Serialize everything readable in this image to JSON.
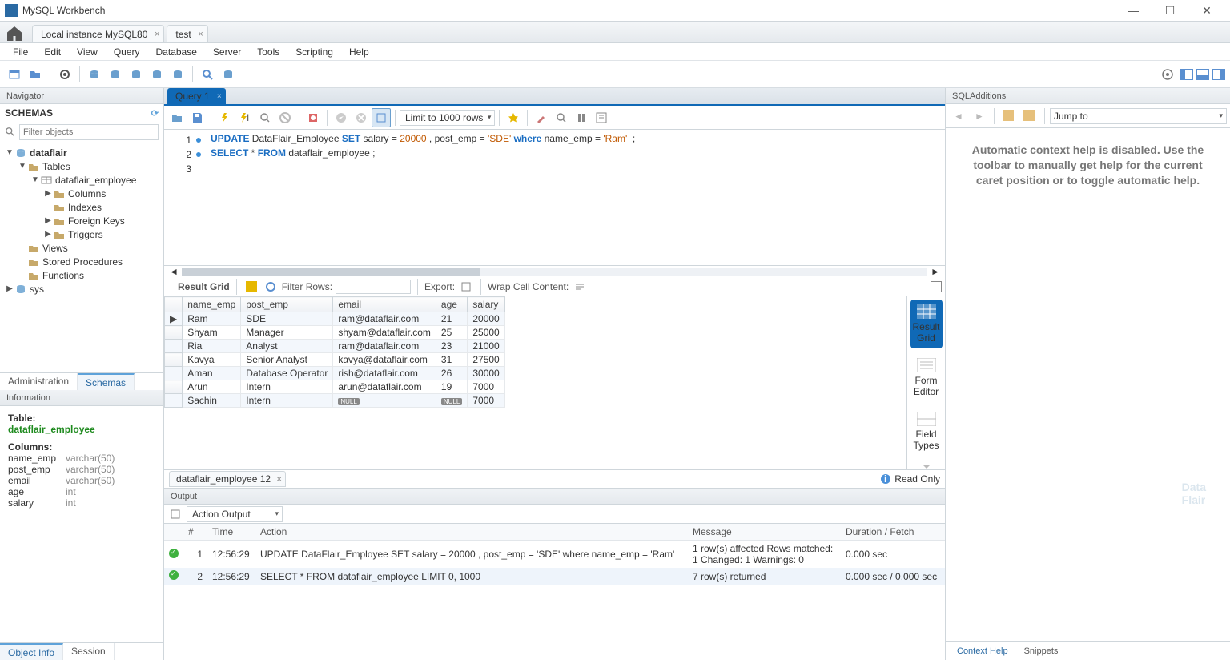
{
  "title": "MySQL Workbench",
  "connTabs": [
    "Local instance MySQL80",
    "test"
  ],
  "menu": [
    "File",
    "Edit",
    "View",
    "Query",
    "Database",
    "Server",
    "Tools",
    "Scripting",
    "Help"
  ],
  "navigator": {
    "head": "Navigator",
    "schemasLabel": "SCHEMAS",
    "filterPlaceholder": "Filter objects",
    "tree": {
      "db": "dataflair",
      "tables": "Tables",
      "table": "dataflair_employee",
      "columns": "Columns",
      "indexes": "Indexes",
      "fks": "Foreign Keys",
      "triggers": "Triggers",
      "views": "Views",
      "sps": "Stored Procedures",
      "funcs": "Functions",
      "sys": "sys"
    },
    "tabs": {
      "admin": "Administration",
      "schemas": "Schemas"
    }
  },
  "info": {
    "head": "Information",
    "tableLabel": "Table:",
    "tableName": "dataflair_employee",
    "columnsLabel": "Columns:",
    "cols": [
      [
        "name_emp",
        "varchar(50)"
      ],
      [
        "post_emp",
        "varchar(50)"
      ],
      [
        "email",
        "varchar(50)"
      ],
      [
        "age",
        "int"
      ],
      [
        "salary",
        "int"
      ]
    ],
    "tabs": {
      "obj": "Object Info",
      "session": "Session"
    }
  },
  "query": {
    "tab": "Query 1",
    "limit": "Limit to 1000 rows",
    "lines": [
      {
        "n": "1",
        "dot": true,
        "html": "<span class='kw'>UPDATE</span> DataFlair_Employee <span class='kw'>SET</span> salary = <span class='num'>20000</span> , post_emp = <span class='str'>'SDE'</span> <span class='kw'>where</span> name_emp = <span class='str'>'Ram'</span>  ;"
      },
      {
        "n": "2",
        "dot": true,
        "html": "<span class='kw'>SELECT</span> * <span class='kw'>FROM</span> dataflair_employee ;"
      },
      {
        "n": "3",
        "dot": false,
        "html": "<span class='cursor'></span>"
      }
    ]
  },
  "result": {
    "barLabel": "Result Grid",
    "filterLabel": "Filter Rows:",
    "exportLabel": "Export:",
    "wrapLabel": "Wrap Cell Content:",
    "cols": [
      "name_emp",
      "post_emp",
      "email",
      "age",
      "salary"
    ],
    "rows": [
      [
        "Ram",
        "SDE",
        "ram@dataflair.com",
        "21",
        "20000"
      ],
      [
        "Shyam",
        "Manager",
        "shyam@dataflair.com",
        "25",
        "25000"
      ],
      [
        "Ria",
        "Analyst",
        "ram@dataflair.com",
        "23",
        "21000"
      ],
      [
        "Kavya",
        "Senior Analyst",
        "kavya@dataflair.com",
        "31",
        "27500"
      ],
      [
        "Aman",
        "Database Operator",
        "rish@dataflair.com",
        "26",
        "30000"
      ],
      [
        "Arun",
        "Intern",
        "arun@dataflair.com",
        "19",
        "7000"
      ],
      [
        "Sachin",
        "Intern",
        "NULL",
        "NULL",
        "7000"
      ]
    ],
    "sideBtns": {
      "grid": "Result\nGrid",
      "form": "Form\nEditor",
      "field": "Field\nTypes"
    },
    "tabName": "dataflair_employee 12",
    "readOnly": "Read Only"
  },
  "output": {
    "head": "Output",
    "sel": "Action Output",
    "cols": {
      "num": "#",
      "time": "Time",
      "action": "Action",
      "msg": "Message",
      "dur": "Duration / Fetch"
    },
    "rows": [
      {
        "n": "1",
        "t": "12:56:29",
        "a": "UPDATE DataFlair_Employee SET salary = 20000 , post_emp = 'SDE' where name_emp = 'Ram'",
        "m": "1 row(s) affected Rows matched: 1  Changed: 1  Warnings: 0",
        "d": "0.000 sec"
      },
      {
        "n": "2",
        "t": "12:56:29",
        "a": "SELECT * FROM dataflair_employee LIMIT 0, 1000",
        "m": "7 row(s) returned",
        "d": "0.000 sec / 0.000 sec"
      }
    ]
  },
  "sqlAdditions": {
    "head": "SQLAdditions",
    "jump": "Jump to",
    "msg": "Automatic context help is disabled. Use the toolbar to manually get help for the current caret position or to toggle automatic help.",
    "tabs": {
      "ctx": "Context Help",
      "snip": "Snippets"
    }
  }
}
